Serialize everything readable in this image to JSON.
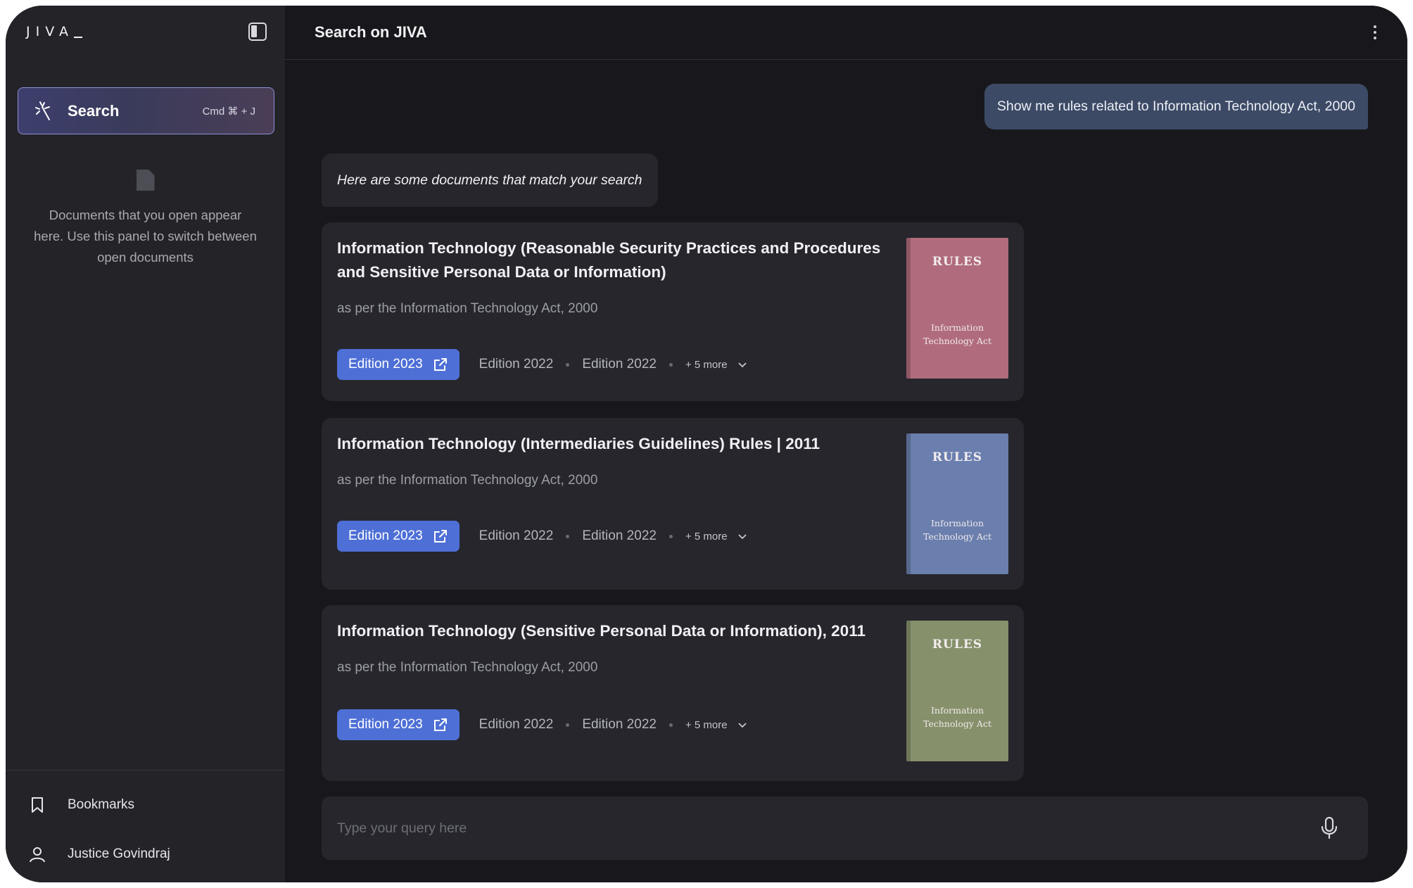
{
  "app": {
    "logo": "JIVA",
    "title": "Search on JIVA"
  },
  "sidebar": {
    "search_label": "Search",
    "search_shortcut": "Cmd ⌘ + J",
    "empty_text": "Documents that you open appear here. Use this panel to switch between open documents",
    "bookmarks_label": "Bookmarks",
    "user_name": "Justice Govindraj"
  },
  "chat": {
    "user_message": "Show me rules related to Information Technology Act, 2000",
    "bot_message": "Here are some documents that match your search"
  },
  "results": [
    {
      "title": "Information Technology (Reasonable Security Practices and Procedures and Sensitive Personal Data or Information)",
      "subtitle": "as per the Information Technology Act, 2000",
      "primary_edition": "Edition 2023",
      "editions": [
        "Edition 2022",
        "Edition 2022"
      ],
      "more": "+ 5 more",
      "book": {
        "label": "RULES",
        "subtitle": "Information Technology Act",
        "color": "#b06c7d"
      }
    },
    {
      "title": "Information Technology (Intermediaries Guidelines) Rules | 2011",
      "subtitle": "as per the Information Technology Act, 2000",
      "primary_edition": "Edition 2023",
      "editions": [
        "Edition 2022",
        "Edition 2022"
      ],
      "more": "+ 5 more",
      "book": {
        "label": "RULES",
        "subtitle": "Information Technology Act",
        "color": "#6b7fae"
      }
    },
    {
      "title": "Information Technology (Sensitive Personal Data or Information), 2011",
      "subtitle": "as per the Information Technology Act, 2000",
      "primary_edition": "Edition 2023",
      "editions": [
        "Edition 2022",
        "Edition 2022"
      ],
      "more": "+ 5 more",
      "book": {
        "label": "RULES",
        "subtitle": "Information Technology Act",
        "color": "#86916b"
      }
    }
  ],
  "query": {
    "placeholder": "Type your query here",
    "value": ""
  },
  "colors": {
    "accent": "#4e6fd6",
    "user_bubble": "#3c4a66",
    "background": "#18181c",
    "panel": "#26262c"
  }
}
